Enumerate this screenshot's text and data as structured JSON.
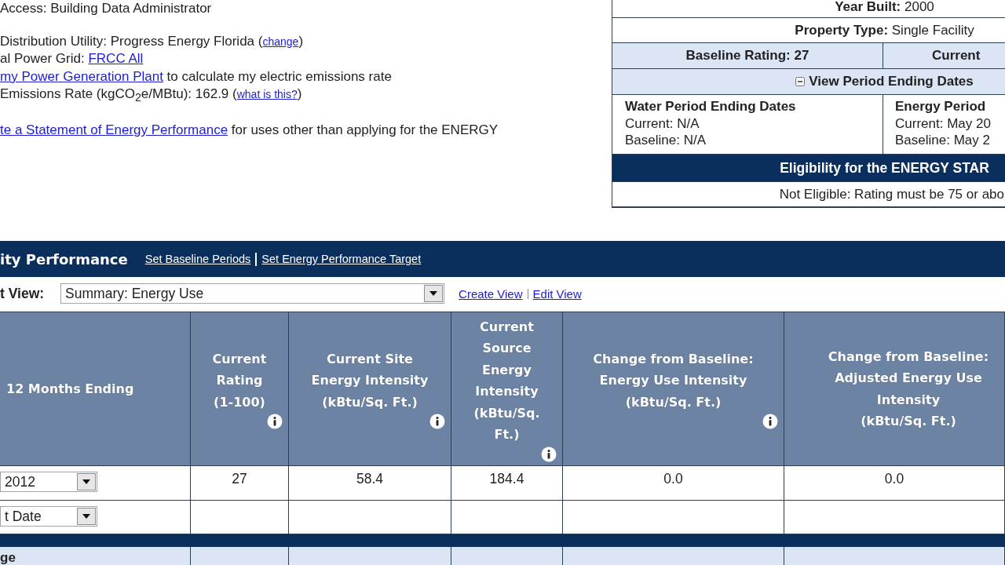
{
  "account_info": {
    "paragraphs": [
      [
        [
          {
            "kind": "text",
            "text": "Access: Building Data Administrator"
          }
        ]
      ],
      [
        [
          {
            "kind": "text",
            "text": "Distribution Utility: Progress Energy Florida ("
          },
          {
            "kind": "small_link",
            "text": "change"
          },
          {
            "kind": "text",
            "text": ")"
          }
        ],
        [
          {
            "kind": "text",
            "text": "al Power Grid: "
          },
          {
            "kind": "link",
            "text": "FRCC All"
          }
        ],
        [
          {
            "kind": "link",
            "text": "my Power Generation Plant"
          },
          {
            "kind": "text",
            "text": " to calculate my electric emissions rate"
          }
        ],
        [
          {
            "kind": "text",
            "text": "Emissions Rate (kgCO$_{2}$e/MBtu): 162.9 ("
          },
          {
            "kind": "small_link",
            "text": "what is this?"
          },
          {
            "kind": "text",
            "text": ")"
          }
        ]
      ],
      [
        [
          {
            "kind": "link",
            "text": "te a Statement of Energy Performance"
          },
          {
            "kind": "text",
            "text": " for uses other than applying for the ENERGY"
          }
        ]
      ]
    ]
  },
  "property_summary": {
    "year_built": {
      "label": "Year Built:",
      "value": "2000"
    },
    "property_type": {
      "label": "Property Type:",
      "value": "Single Facility"
    },
    "ratings": [
      "Baseline Rating: 27",
      "Current"
    ],
    "period_toggle": {
      "label": "View Period Ending Dates",
      "expanded": true
    },
    "periods": [
      {
        "title": "Water Period Ending Dates",
        "lines": [
          "Current: N/A",
          "Baseline: N/A"
        ]
      },
      {
        "title": "Energy Period",
        "lines": [
          "Current: May 20",
          "Baseline: May 2"
        ]
      }
    ],
    "eligibility": {
      "title": "Eligibility for the ENERGY STAR",
      "status": "Not Eligible: Rating must be 75 or abo"
    }
  },
  "performance": {
    "title": "ity Performance",
    "links": [
      "Set Baseline Periods",
      "Set Energy Performance Target"
    ],
    "view_label": "t View:",
    "view_select": {
      "value": "Summary: Energy Use"
    },
    "view_links": [
      "Create View",
      "Edit View"
    ],
    "table": {
      "columns": [
        {
          "label": "12 Months Ending",
          "info": false
        },
        {
          "label": "Current\nRating\n(1-100)",
          "info": true
        },
        {
          "label": "Current Site\nEnergy Intensity\n(kBtu/Sq. Ft.)",
          "info": true
        },
        {
          "label": "Current\nSource\nEnergy\nIntensity\n(kBtu/Sq.\nFt.)",
          "info": true
        },
        {
          "label": "Change from Baseline:\nEnergy Use Intensity\n(kBtu/Sq. Ft.)",
          "info": true
        },
        {
          "label": "Change from Baseline:\nAdjusted Energy Use\nIntensity\n(kBtu/Sq. Ft.)",
          "info": false
        }
      ],
      "rows": [
        {
          "period": {
            "value": "2012"
          },
          "cells": [
            "27",
            "58.4",
            "184.4",
            "0.0",
            "0.0"
          ]
        },
        {
          "period": {
            "value": "t Date"
          }
        }
      ],
      "footer_label": "ge"
    }
  }
}
